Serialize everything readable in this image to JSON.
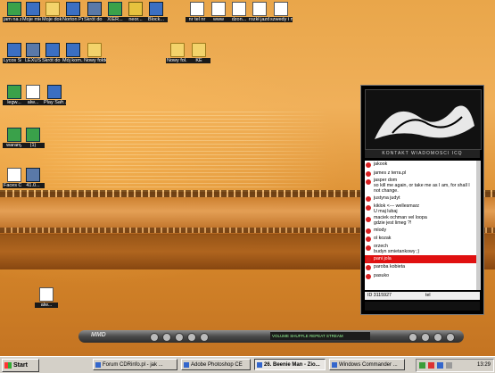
{
  "desktop_icons": [
    {
      "id": "i1",
      "label": "jam na zielo",
      "icon": "app-icon"
    },
    {
      "id": "i2",
      "label": "Moje miej...",
      "icon": "computer-icon"
    },
    {
      "id": "i3",
      "label": "Moje doku...",
      "icon": "folder-icon"
    },
    {
      "id": "i4",
      "label": "Norton Prot...",
      "icon": "shield-icon"
    },
    {
      "id": "i5",
      "label": "Skrót do D...",
      "icon": "app-icon"
    },
    {
      "id": "i6",
      "label": "XIER...",
      "icon": "app-icon"
    },
    {
      "id": "i7",
      "label": "neor...",
      "icon": "zip-icon"
    },
    {
      "id": "i8",
      "label": "Block...",
      "icon": "app-icon"
    },
    {
      "id": "i9",
      "label": "nr tel nr",
      "icon": "document-icon"
    },
    {
      "id": "i10",
      "label": "www",
      "icon": "document-icon"
    },
    {
      "id": "i11",
      "label": "dzon...",
      "icon": "document-icon"
    },
    {
      "id": "i12",
      "label": "rozkł jazd...",
      "icon": "document-icon"
    },
    {
      "id": "i13",
      "label": "szwedy i niet...",
      "icon": "document-icon"
    },
    {
      "id": "i14",
      "label": "Lycos Sides...",
      "icon": "app-icon"
    },
    {
      "id": "i15",
      "label": "LEXUS",
      "icon": "app-icon"
    },
    {
      "id": "i16",
      "label": "Skrót do ET",
      "icon": "app-icon"
    },
    {
      "id": "i17",
      "label": "Mój kom...",
      "icon": "computer-icon"
    },
    {
      "id": "i18",
      "label": "Nowy folder",
      "icon": "folder-icon"
    },
    {
      "id": "i19",
      "label": "Nowy fol...",
      "icon": "folder-icon"
    },
    {
      "id": "i20",
      "label": "KE",
      "icon": "folder-icon"
    },
    {
      "id": "i21",
      "label": "legw...",
      "icon": "app-icon"
    },
    {
      "id": "i22",
      "label": "alw...",
      "icon": "document-icon"
    },
    {
      "id": "i23",
      "label": "Play Safr...",
      "icon": "app-icon"
    },
    {
      "id": "i24",
      "label": "warany",
      "icon": "app-icon"
    },
    {
      "id": "i25",
      "label": "(1)",
      "icon": "app-icon"
    },
    {
      "id": "i26",
      "label": "Faces Of De...",
      "icon": "document-icon"
    },
    {
      "id": "i27",
      "label": "41.0...",
      "icon": "disk-icon"
    },
    {
      "id": "i28",
      "label": "alw...",
      "icon": "document-icon"
    }
  ],
  "contacts": {
    "subtitle": "KONTAKT WIADOMOSCI ICQ",
    "items": [
      {
        "name": "jakook",
        "status": ""
      },
      {
        "name": "james z terra.pl",
        "status": ""
      },
      {
        "name": "jasper dom",
        "status": "so kill me again, or take me as I am, for shall I not change."
      },
      {
        "name": "justyna judyt",
        "status": ""
      },
      {
        "name": "kiklok <--- wellesmarz",
        "status": "U maj lubaj"
      },
      {
        "name": "maciek ochman vel loopa",
        "status": "gdzie jest limeg ?!"
      },
      {
        "name": "mlody",
        "status": ""
      },
      {
        "name": "ol kozak",
        "status": ""
      },
      {
        "name": "orzech",
        "status": "budyn smietankowy ;)"
      },
      {
        "name": "pani jola",
        "status": "",
        "selected": true
      },
      {
        "name": "paroba kobieta",
        "status": ""
      },
      {
        "name": "pasuko",
        "status": ""
      }
    ],
    "footer_id": "ID 3115927",
    "footer_tel": "tel"
  },
  "player": {
    "logo": "MMD",
    "display": "VOLUME  SHUFFLE  REPEAT  STREAM"
  },
  "taskbar": {
    "start_label": "Start",
    "buttons": [
      {
        "label": "Forum CDRinfo.pl - jak ...",
        "active": false
      },
      {
        "label": "Adobe Photoshop CE",
        "active": false
      },
      {
        "label": "26. Beenie Man - Zio...",
        "active": true
      },
      {
        "label": "Windows Commander ...",
        "active": false
      }
    ],
    "clock": "13:29"
  },
  "colors": {
    "accent": "#e01010",
    "desktop": "#e9a64a"
  }
}
